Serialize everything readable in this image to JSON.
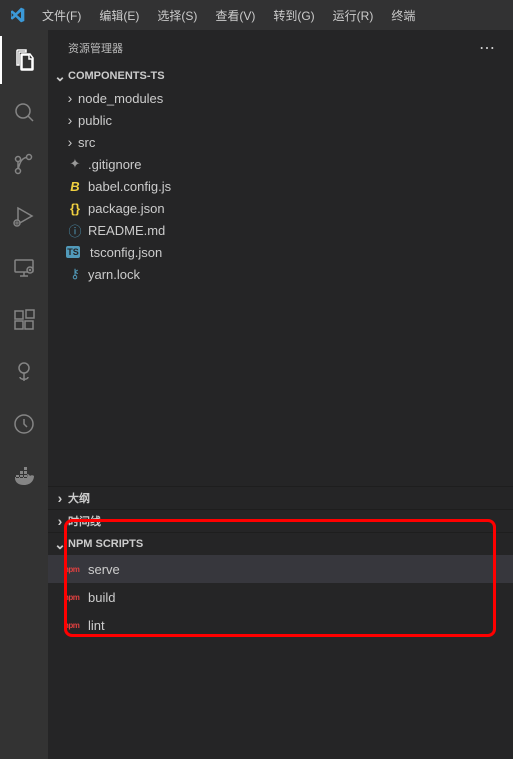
{
  "menus": {
    "file": "文件(F)",
    "edit": "编辑(E)",
    "select": "选择(S)",
    "view": "查看(V)",
    "go": "转到(G)",
    "run": "运行(R)",
    "terminal": "终端"
  },
  "sidebar": {
    "title": "资源管理器",
    "project_name": "COMPONENTS-TS",
    "tree": {
      "folders": [
        {
          "name": "node_modules"
        },
        {
          "name": "public"
        },
        {
          "name": "src"
        }
      ],
      "files": [
        {
          "name": ".gitignore",
          "icon_color": "#999999",
          "icon": "git"
        },
        {
          "name": "babel.config.js",
          "icon_color": "#f0d040",
          "icon": "babel"
        },
        {
          "name": "package.json",
          "icon_color": "#f0d040",
          "icon": "json"
        },
        {
          "name": "README.md",
          "icon_color": "#519aba",
          "icon": "info"
        },
        {
          "name": "tsconfig.json",
          "icon_color": "#519aba",
          "icon": "ts"
        },
        {
          "name": "yarn.lock",
          "icon_color": "#519aba",
          "icon": "yarn"
        }
      ]
    },
    "outline": "大纲",
    "timeline": "时间线",
    "npm_scripts": {
      "title": "NPM SCRIPTS",
      "items": [
        {
          "name": "serve",
          "selected": true
        },
        {
          "name": "build",
          "selected": false
        },
        {
          "name": "lint",
          "selected": false
        }
      ]
    }
  },
  "icons": {
    "npm": "npm"
  }
}
